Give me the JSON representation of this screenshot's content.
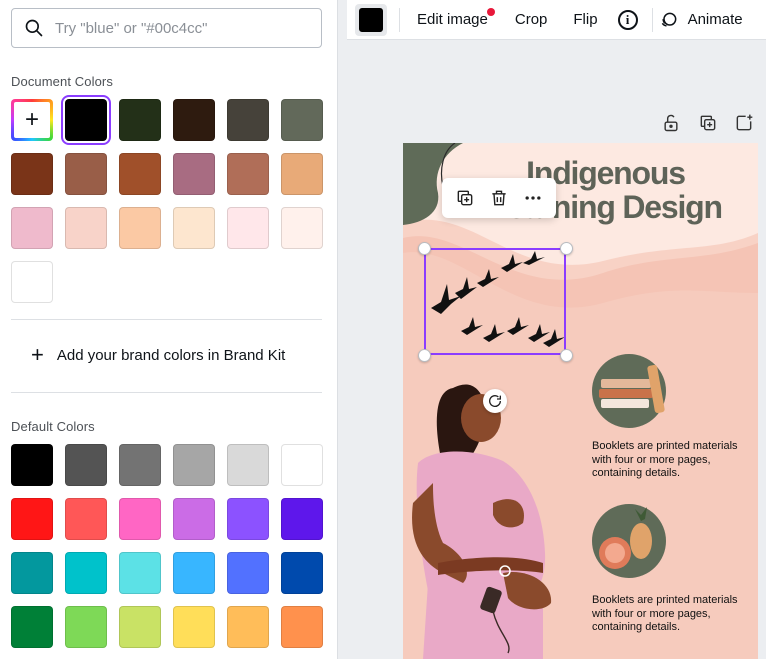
{
  "search": {
    "placeholder": "Try \"blue\" or \"#00c4cc\""
  },
  "document_colors": {
    "title": "Document Colors",
    "add_label": "+",
    "selected": "#000000",
    "swatches": [
      "#000000",
      "#233018",
      "#2e1b0f",
      "#46423a",
      "#62695a",
      "#7a3418",
      "#995e48",
      "#a0502a",
      "#a86c82",
      "#b06e58",
      "#e8aa78",
      "#efbacc",
      "#f8d3c9",
      "#fbc9a4",
      "#fde6cf",
      "#ffe7ea",
      "#fff1ec",
      "#ffffff"
    ]
  },
  "brand_kit": {
    "icon": "plus-icon",
    "label": "Add your brand colors in Brand Kit"
  },
  "default_colors": {
    "title": "Default Colors",
    "swatches": [
      "#000000",
      "#545454",
      "#737373",
      "#a6a6a6",
      "#d9d9d9",
      "#ffffff",
      "#ff1616",
      "#ff5757",
      "#ff66c4",
      "#cb6ce6",
      "#8c52ff",
      "#5e17eb",
      "#03989e",
      "#00c2cb",
      "#5ce1e6",
      "#38b6ff",
      "#5271ff",
      "#004aad",
      "#008037",
      "#7ed957",
      "#c9e265",
      "#ffde59",
      "#ffbd59",
      "#ff914d"
    ]
  },
  "toolbar": {
    "color_chip": "#000000",
    "edit_image": "Edit image",
    "crop": "Crop",
    "flip": "Flip",
    "info": "i",
    "animate": "Animate"
  },
  "canvas": {
    "headline_line1": "Indigenous",
    "headline_line2": "Learning Design",
    "caption_1": "Booklets are printed materials with four or more pages, containing details.",
    "caption_2": "Booklets are printed materials with four or more pages, containing details."
  },
  "colors": {
    "accent": "#8b3dff",
    "notification": "#e8183a"
  }
}
